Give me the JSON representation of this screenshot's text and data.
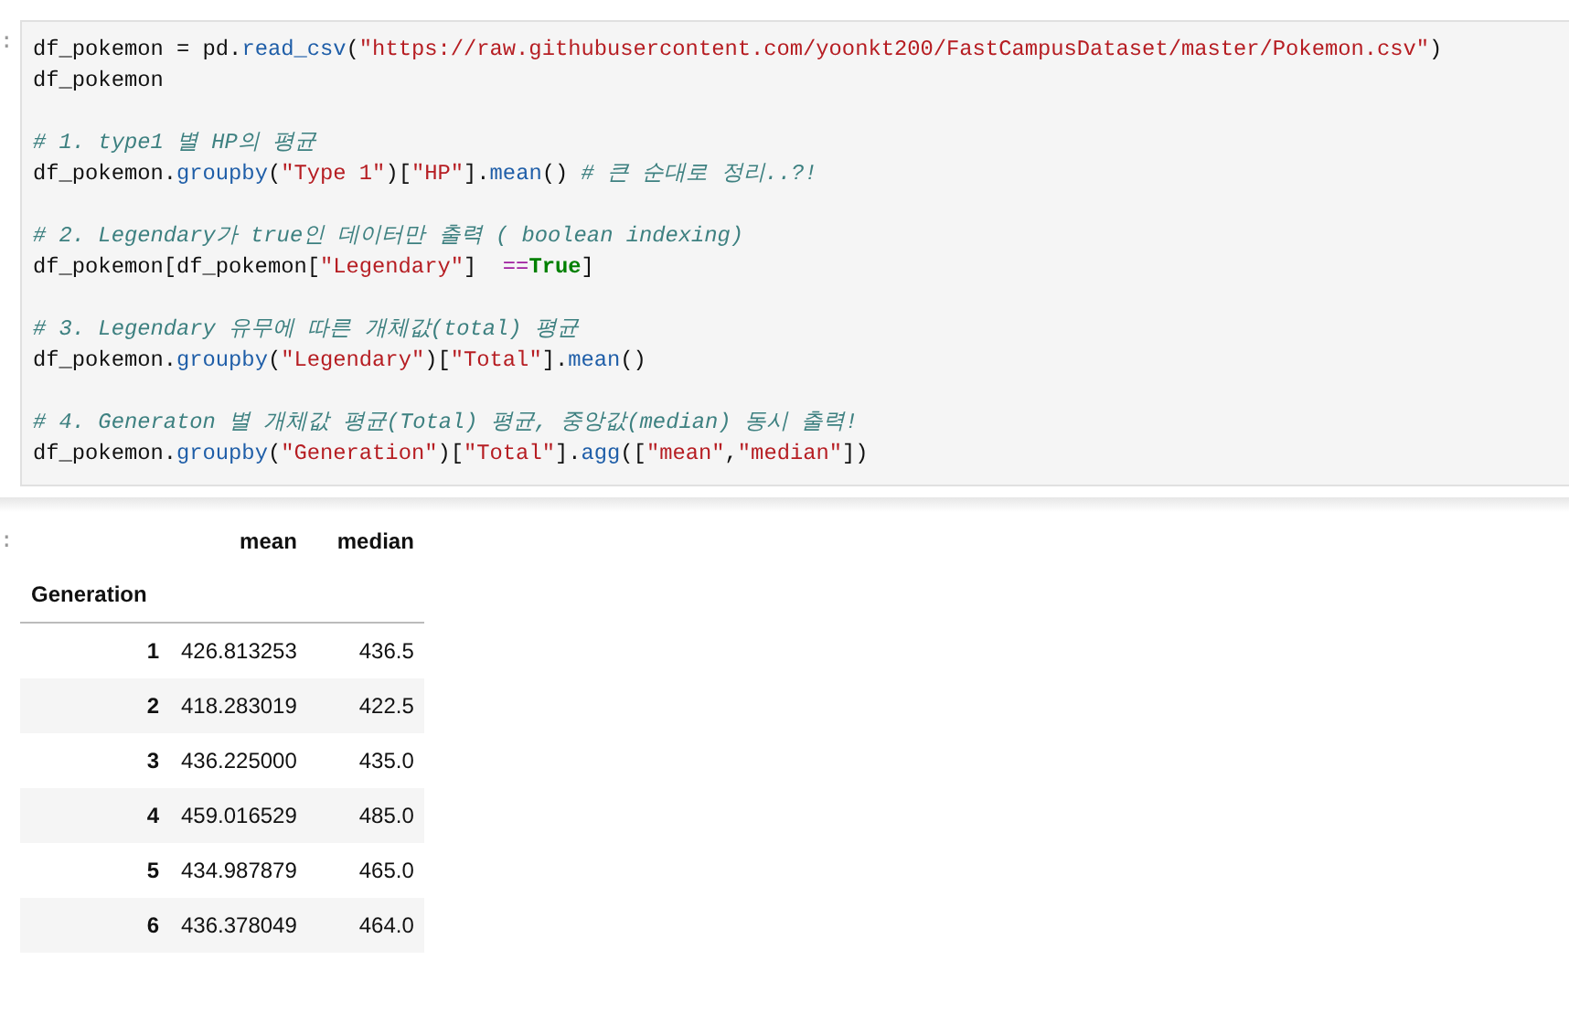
{
  "code_cell": {
    "prompt": ":",
    "lines": [
      {
        "kind": "code",
        "tokens": [
          {
            "kind": "name",
            "text": "df_pokemon "
          },
          {
            "kind": "op",
            "text": "="
          },
          {
            "kind": "name",
            "text": " pd."
          },
          {
            "kind": "call",
            "text": "read_csv"
          },
          {
            "kind": "name",
            "text": "("
          },
          {
            "kind": "str",
            "text": "\"https://raw.githubusercontent.com/yoonkt200/FastCampusDataset/master/Pokemon.csv\""
          },
          {
            "kind": "name",
            "text": ")"
          }
        ]
      },
      {
        "kind": "code",
        "tokens": [
          {
            "kind": "name",
            "text": "df_pokemon"
          }
        ]
      },
      {
        "kind": "blank"
      },
      {
        "kind": "code",
        "tokens": [
          {
            "kind": "comment",
            "text": "# 1. type1 별 HP의 평균"
          }
        ]
      },
      {
        "kind": "code",
        "tokens": [
          {
            "kind": "name",
            "text": "df_pokemon."
          },
          {
            "kind": "call",
            "text": "groupby"
          },
          {
            "kind": "name",
            "text": "("
          },
          {
            "kind": "str",
            "text": "\"Type 1\""
          },
          {
            "kind": "name",
            "text": ")["
          },
          {
            "kind": "str",
            "text": "\"HP\""
          },
          {
            "kind": "name",
            "text": "]."
          },
          {
            "kind": "call",
            "text": "mean"
          },
          {
            "kind": "name",
            "text": "() "
          },
          {
            "kind": "comment",
            "text": "# 큰 순대로 정리..?!"
          }
        ]
      },
      {
        "kind": "blank"
      },
      {
        "kind": "code",
        "tokens": [
          {
            "kind": "comment",
            "text": "# 2. Legendary가 true인 데이터만 출력 ( boolean indexing)"
          }
        ]
      },
      {
        "kind": "code",
        "tokens": [
          {
            "kind": "name",
            "text": "df_pokemon[df_pokemon["
          },
          {
            "kind": "str",
            "text": "\"Legendary\""
          },
          {
            "kind": "name",
            "text": "]  "
          },
          {
            "kind": "op2",
            "text": "=="
          },
          {
            "kind": "keyword",
            "text": "True"
          },
          {
            "kind": "name",
            "text": "]"
          }
        ]
      },
      {
        "kind": "blank"
      },
      {
        "kind": "code",
        "tokens": [
          {
            "kind": "comment",
            "text": "# 3. Legendary 유무에 따른 개체값(total) 평균"
          }
        ]
      },
      {
        "kind": "code",
        "tokens": [
          {
            "kind": "name",
            "text": "df_pokemon."
          },
          {
            "kind": "call",
            "text": "groupby"
          },
          {
            "kind": "name",
            "text": "("
          },
          {
            "kind": "str",
            "text": "\"Legendary\""
          },
          {
            "kind": "name",
            "text": ")["
          },
          {
            "kind": "str",
            "text": "\"Total\""
          },
          {
            "kind": "name",
            "text": "]."
          },
          {
            "kind": "call",
            "text": "mean"
          },
          {
            "kind": "name",
            "text": "()"
          }
        ]
      },
      {
        "kind": "blank"
      },
      {
        "kind": "code",
        "tokens": [
          {
            "kind": "comment",
            "text": "# 4. Generaton 별 개체값 평균(Total) 평균, 중앙값(median) 동시 출력!"
          }
        ]
      },
      {
        "kind": "code",
        "tokens": [
          {
            "kind": "name",
            "text": "df_pokemon."
          },
          {
            "kind": "call",
            "text": "groupby"
          },
          {
            "kind": "name",
            "text": "("
          },
          {
            "kind": "str",
            "text": "\"Generation\""
          },
          {
            "kind": "name",
            "text": ")["
          },
          {
            "kind": "str",
            "text": "\"Total\""
          },
          {
            "kind": "name",
            "text": "]."
          },
          {
            "kind": "call",
            "text": "agg"
          },
          {
            "kind": "name",
            "text": "(["
          },
          {
            "kind": "str",
            "text": "\"mean\""
          },
          {
            "kind": "name",
            "text": ","
          },
          {
            "kind": "str",
            "text": "\"median\""
          },
          {
            "kind": "name",
            "text": "])"
          }
        ]
      }
    ]
  },
  "output": {
    "prompt": ":",
    "table": {
      "columns": [
        "mean",
        "median"
      ],
      "index_name": "Generation",
      "rows": [
        {
          "index": "1",
          "cells": [
            "426.813253",
            "436.5"
          ]
        },
        {
          "index": "2",
          "cells": [
            "418.283019",
            "422.5"
          ]
        },
        {
          "index": "3",
          "cells": [
            "436.225000",
            "435.0"
          ]
        },
        {
          "index": "4",
          "cells": [
            "459.016529",
            "485.0"
          ]
        },
        {
          "index": "5",
          "cells": [
            "434.987879",
            "465.0"
          ]
        },
        {
          "index": "6",
          "cells": [
            "436.378049",
            "464.0"
          ]
        }
      ]
    }
  }
}
